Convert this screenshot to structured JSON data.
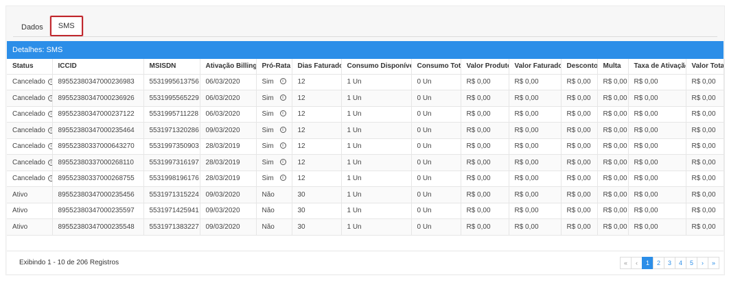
{
  "tabs": [
    {
      "label": "Dados",
      "active": false
    },
    {
      "label": "SMS",
      "active": true
    }
  ],
  "detail_title": "Detalhes: SMS",
  "columns": [
    "Status",
    "ICCID",
    "MSISDN",
    "Ativação Billing",
    "Pró-Rata",
    "Dias Faturados",
    "Consumo Disponível",
    "Consumo Total",
    "Valor Produto",
    "Valor Faturado",
    "Desconto",
    "Multa",
    "Taxa de Ativação",
    "Valor Total"
  ],
  "rows": [
    {
      "status": "Cancelado",
      "status_info": true,
      "iccid": "89552380347000236983",
      "msisdn": "5531995613756",
      "ativacao": "06/03/2020",
      "prorata": "Sim",
      "prorata_info": true,
      "dias": "12",
      "disp": "1 Un",
      "total": "0 Un",
      "vprod": "R$ 0,00",
      "vfat": "R$ 0,00",
      "desc": "R$ 0,00",
      "multa": "R$ 0,00",
      "taxa": "R$ 0,00",
      "vtotal": "R$ 0,00"
    },
    {
      "status": "Cancelado",
      "status_info": true,
      "iccid": "89552380347000236926",
      "msisdn": "5531995565229",
      "ativacao": "06/03/2020",
      "prorata": "Sim",
      "prorata_info": true,
      "dias": "12",
      "disp": "1 Un",
      "total": "0 Un",
      "vprod": "R$ 0,00",
      "vfat": "R$ 0,00",
      "desc": "R$ 0,00",
      "multa": "R$ 0,00",
      "taxa": "R$ 0,00",
      "vtotal": "R$ 0,00"
    },
    {
      "status": "Cancelado",
      "status_info": true,
      "iccid": "89552380347000237122",
      "msisdn": "5531995711228",
      "ativacao": "06/03/2020",
      "prorata": "Sim",
      "prorata_info": true,
      "dias": "12",
      "disp": "1 Un",
      "total": "0 Un",
      "vprod": "R$ 0,00",
      "vfat": "R$ 0,00",
      "desc": "R$ 0,00",
      "multa": "R$ 0,00",
      "taxa": "R$ 0,00",
      "vtotal": "R$ 0,00"
    },
    {
      "status": "Cancelado",
      "status_info": true,
      "iccid": "89552380347000235464",
      "msisdn": "5531971320286",
      "ativacao": "09/03/2020",
      "prorata": "Sim",
      "prorata_info": true,
      "dias": "12",
      "disp": "1 Un",
      "total": "0 Un",
      "vprod": "R$ 0,00",
      "vfat": "R$ 0,00",
      "desc": "R$ 0,00",
      "multa": "R$ 0,00",
      "taxa": "R$ 0,00",
      "vtotal": "R$ 0,00"
    },
    {
      "status": "Cancelado",
      "status_info": true,
      "iccid": "89552380337000643270",
      "msisdn": "5531997350903",
      "ativacao": "28/03/2019",
      "prorata": "Sim",
      "prorata_info": true,
      "dias": "12",
      "disp": "1 Un",
      "total": "0 Un",
      "vprod": "R$ 0,00",
      "vfat": "R$ 0,00",
      "desc": "R$ 0,00",
      "multa": "R$ 0,00",
      "taxa": "R$ 0,00",
      "vtotal": "R$ 0,00"
    },
    {
      "status": "Cancelado",
      "status_info": true,
      "iccid": "89552380337000268110",
      "msisdn": "5531997316197",
      "ativacao": "28/03/2019",
      "prorata": "Sim",
      "prorata_info": true,
      "dias": "12",
      "disp": "1 Un",
      "total": "0 Un",
      "vprod": "R$ 0,00",
      "vfat": "R$ 0,00",
      "desc": "R$ 0,00",
      "multa": "R$ 0,00",
      "taxa": "R$ 0,00",
      "vtotal": "R$ 0,00"
    },
    {
      "status": "Cancelado",
      "status_info": true,
      "iccid": "89552380337000268755",
      "msisdn": "5531998196176",
      "ativacao": "28/03/2019",
      "prorata": "Sim",
      "prorata_info": true,
      "dias": "12",
      "disp": "1 Un",
      "total": "0 Un",
      "vprod": "R$ 0,00",
      "vfat": "R$ 0,00",
      "desc": "R$ 0,00",
      "multa": "R$ 0,00",
      "taxa": "R$ 0,00",
      "vtotal": "R$ 0,00"
    },
    {
      "status": "Ativo",
      "status_info": false,
      "iccid": "89552380347000235456",
      "msisdn": "5531971315224",
      "ativacao": "09/03/2020",
      "prorata": "Não",
      "prorata_info": false,
      "dias": "30",
      "disp": "1 Un",
      "total": "0 Un",
      "vprod": "R$ 0,00",
      "vfat": "R$ 0,00",
      "desc": "R$ 0,00",
      "multa": "R$ 0,00",
      "taxa": "R$ 0,00",
      "vtotal": "R$ 0,00"
    },
    {
      "status": "Ativo",
      "status_info": false,
      "iccid": "89552380347000235597",
      "msisdn": "5531971425941",
      "ativacao": "09/03/2020",
      "prorata": "Não",
      "prorata_info": false,
      "dias": "30",
      "disp": "1 Un",
      "total": "0 Un",
      "vprod": "R$ 0,00",
      "vfat": "R$ 0,00",
      "desc": "R$ 0,00",
      "multa": "R$ 0,00",
      "taxa": "R$ 0,00",
      "vtotal": "R$ 0,00"
    },
    {
      "status": "Ativo",
      "status_info": false,
      "iccid": "89552380347000235548",
      "msisdn": "5531971383227",
      "ativacao": "09/03/2020",
      "prorata": "Não",
      "prorata_info": false,
      "dias": "30",
      "disp": "1 Un",
      "total": "0 Un",
      "vprod": "R$ 0,00",
      "vfat": "R$ 0,00",
      "desc": "R$ 0,00",
      "multa": "R$ 0,00",
      "taxa": "R$ 0,00",
      "vtotal": "R$ 0,00"
    }
  ],
  "records_text": "Exibindo 1 - 10 de 206 Registros",
  "pagination": [
    {
      "label": "«",
      "name": "page-first-button",
      "state": "muted"
    },
    {
      "label": "‹",
      "name": "page-prev-button",
      "state": "muted"
    },
    {
      "label": "1",
      "name": "page-1-button",
      "state": "active"
    },
    {
      "label": "2",
      "name": "page-2-button",
      "state": ""
    },
    {
      "label": "3",
      "name": "page-3-button",
      "state": ""
    },
    {
      "label": "4",
      "name": "page-4-button",
      "state": ""
    },
    {
      "label": "5",
      "name": "page-5-button",
      "state": ""
    },
    {
      "label": "›",
      "name": "page-next-button",
      "state": ""
    },
    {
      "label": "»",
      "name": "page-last-button",
      "state": ""
    }
  ],
  "info_icon_glyph": "i"
}
